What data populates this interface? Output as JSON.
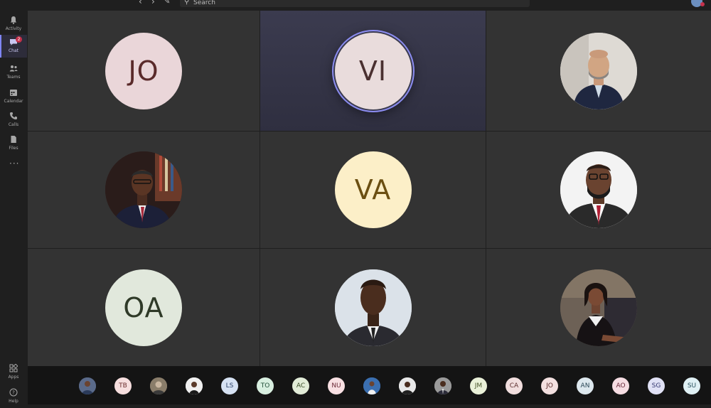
{
  "top_bar": {
    "search_placeholder": "Search",
    "back_icon": "chevron-left-icon",
    "forward_icon": "chevron-right-icon",
    "compose_icon": "compose-icon"
  },
  "rail": {
    "items": [
      {
        "label": "Activity",
        "icon": "bell-icon"
      },
      {
        "label": "Chat",
        "icon": "chat-icon",
        "badge": "2"
      },
      {
        "label": "Teams",
        "icon": "teams-icon"
      },
      {
        "label": "Calendar",
        "icon": "calendar-icon"
      },
      {
        "label": "Calls",
        "icon": "phone-icon"
      },
      {
        "label": "Files",
        "icon": "file-icon"
      },
      {
        "label": "",
        "icon": "more-icon"
      },
      {
        "label": "Apps",
        "icon": "apps-icon"
      },
      {
        "label": "Help",
        "icon": "help-icon"
      }
    ]
  },
  "tiles": [
    {
      "initials": "JO",
      "bg": "#ead6d9",
      "fg": "#5a2a2a",
      "speaking": false
    },
    {
      "initials": "VI",
      "bg": "#e9dcdc",
      "fg": "#4a3030",
      "speaking": true
    },
    {
      "initials": "",
      "photo": "man-beard-suit",
      "bg": "#d9d4cf"
    },
    {
      "initials": "",
      "photo": "man-glasses-red-tie",
      "bg": "#3a1f1f"
    },
    {
      "initials": "VA",
      "bg": "#fcefc8",
      "fg": "#6b4f12",
      "speaking": false
    },
    {
      "initials": "",
      "photo": "man-glasses-beard",
      "bg": "#f1f1f1"
    },
    {
      "initials": "OA",
      "bg": "#e1e8dc",
      "fg": "#2f3a28",
      "speaking": false
    },
    {
      "initials": "",
      "photo": "man-tie-portrait",
      "bg": "#d8dfe6"
    },
    {
      "initials": "",
      "photo": "woman-seated",
      "bg": "#5a5048"
    }
  ],
  "roster": [
    {
      "initials": "",
      "photo": "person",
      "bg": "#5a6a8a"
    },
    {
      "initials": "TB",
      "bg": "#f6dede",
      "fg": "#6b2d2d"
    },
    {
      "initials": "",
      "photo": "person",
      "bg": "#8a7d6a"
    },
    {
      "initials": "",
      "photo": "person",
      "bg": "#f0f0f0"
    },
    {
      "initials": "LS",
      "bg": "#d6e2f3",
      "fg": "#2a3f66"
    },
    {
      "initials": "TO",
      "bg": "#d8efe0",
      "fg": "#23503a"
    },
    {
      "initials": "AC",
      "bg": "#e2ecd8",
      "fg": "#3a4d27"
    },
    {
      "initials": "NU",
      "bg": "#f8e0e3",
      "fg": "#6b2836"
    },
    {
      "initials": "",
      "photo": "person",
      "bg": "#3b6fb0"
    },
    {
      "initials": "",
      "photo": "person",
      "bg": "#e8e8e8"
    },
    {
      "initials": "",
      "photo": "person",
      "bg": "#9a9a9a"
    },
    {
      "initials": "JM",
      "bg": "#eaf1d9",
      "fg": "#48552a"
    },
    {
      "initials": "CA",
      "bg": "#f1dede",
      "fg": "#5e2f2f"
    },
    {
      "initials": "JO",
      "bg": "#f3e0e0",
      "fg": "#5a2a2a"
    },
    {
      "initials": "AN",
      "bg": "#dde8ee",
      "fg": "#2a4756"
    },
    {
      "initials": "AO",
      "bg": "#f6dde3",
      "fg": "#6a2a3b"
    },
    {
      "initials": "SG",
      "bg": "#e0e1f5",
      "fg": "#343770"
    },
    {
      "initials": "SU",
      "bg": "#dff0f4",
      "fg": "#27505c"
    }
  ]
}
